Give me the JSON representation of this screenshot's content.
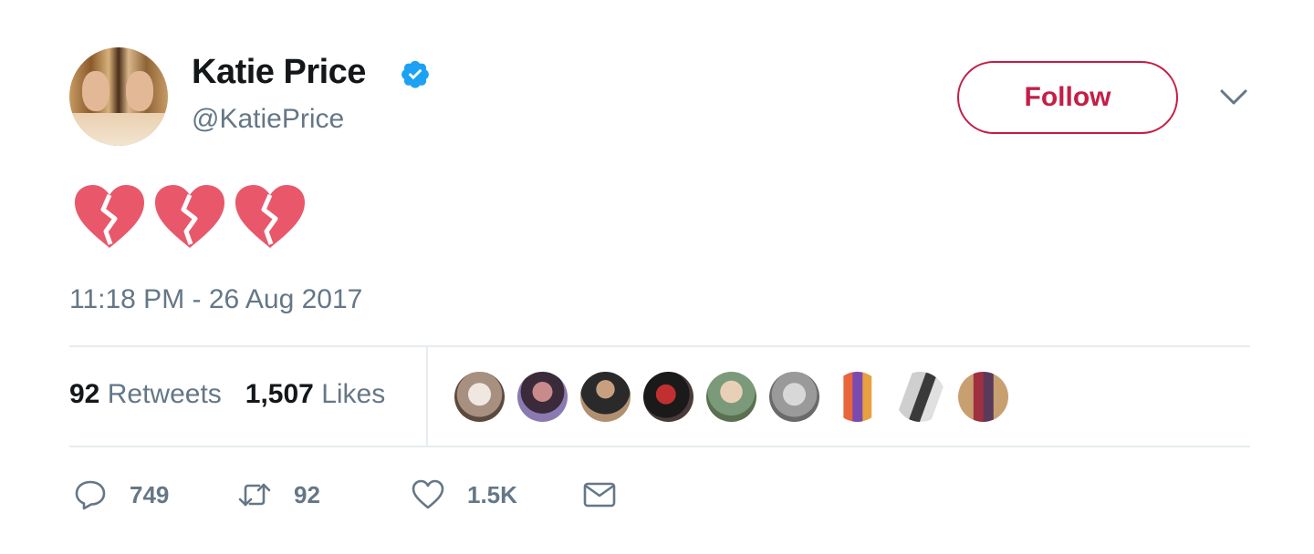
{
  "user": {
    "name": "Katie Price",
    "handle": "@KatiePrice",
    "verified_icon": "verified-badge-icon",
    "avatar_icon": "profile-photo"
  },
  "header": {
    "follow_label": "Follow",
    "menu_icon": "chevron-down-icon"
  },
  "tweet": {
    "content_emoji": [
      "broken-heart",
      "broken-heart",
      "broken-heart"
    ],
    "timestamp": "11:18 PM - 26 Aug 2017"
  },
  "stats": {
    "retweets_count": "92",
    "retweets_label": "Retweets",
    "likes_count": "1,507",
    "likes_label": "Likes",
    "likers_count_shown": 9
  },
  "actions": {
    "reply_count": "749",
    "retweet_count": "92",
    "like_count": "1.5K",
    "reply_icon": "reply-icon",
    "retweet_icon": "retweet-icon",
    "like_icon": "heart-icon",
    "message_icon": "envelope-icon"
  },
  "colors": {
    "follow_accent": "#c41e47",
    "verified_blue": "#1da1f2",
    "heart_pink": "#e8586a",
    "secondary_text": "#657786",
    "divider": "#e6ecf0"
  }
}
